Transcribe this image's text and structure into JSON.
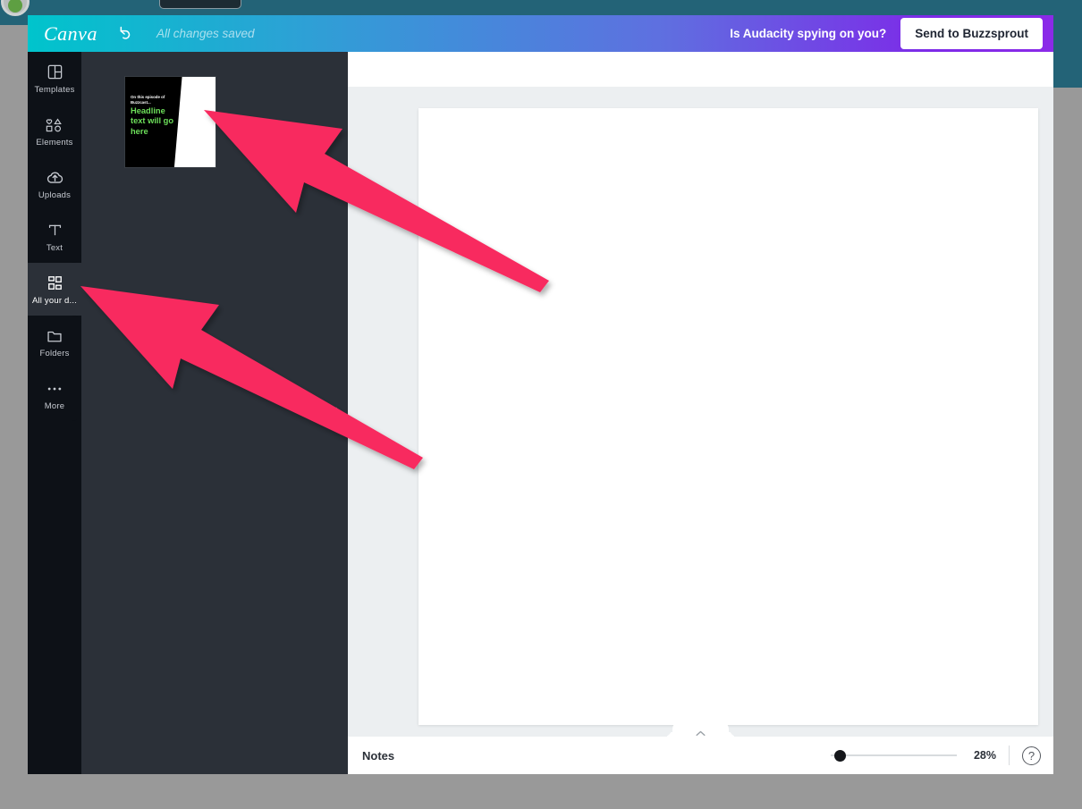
{
  "window": {
    "app_name": "Canva"
  },
  "underlay": {
    "avatar_icon": "user-avatar",
    "search_icon": "search-box"
  },
  "header": {
    "logo_text": "Canva",
    "undo_icon": "undo-arrow-icon",
    "save_status": "All changes saved",
    "doc_title": "Is Audacity spying on you?",
    "send_button": "Send to Buzzsprout"
  },
  "sidebar": {
    "items": [
      {
        "label": "Templates",
        "icon": "templates-icon",
        "active": false
      },
      {
        "label": "Elements",
        "icon": "elements-icon",
        "active": false
      },
      {
        "label": "Uploads",
        "icon": "uploads-cloud-icon",
        "active": false
      },
      {
        "label": "Text",
        "icon": "text-icon",
        "active": false
      },
      {
        "label": "All your d...",
        "icon": "all-your-designs-grid-icon",
        "active": true
      },
      {
        "label": "Folders",
        "icon": "folder-icon",
        "active": false
      },
      {
        "label": "More",
        "icon": "more-dots-icon",
        "active": false
      }
    ]
  },
  "panel": {
    "collapse_icon": "chevron-left-icon",
    "thumbnail": {
      "eyebrow": "On this episode of Buzzcast...",
      "headline": "Headline text will go here",
      "headline_color": "#6ddf5a",
      "background_color": "#000000"
    }
  },
  "notes": {
    "label": "Notes",
    "expand_icon": "chevron-up-icon"
  },
  "zoom": {
    "value": "28%",
    "percent": 28,
    "help_icon": "question-mark-icon"
  },
  "annotations": {
    "arrow_color": "#f8295e",
    "arrows": [
      {
        "name": "arrow-to-thumbnail",
        "points_at": "design-thumbnail"
      },
      {
        "name": "arrow-to-all-your-designs",
        "points_at": "sidebar-item-all-your-designs"
      }
    ]
  },
  "colors": {
    "header_gradient_start": "#00c4cc",
    "header_gradient_end": "#7d2ae8",
    "panel_background": "#2b3038",
    "rail_background": "#0d1117",
    "canvas_background": "#eceff1",
    "desktop_background": "#999999",
    "underlay_background": "#236377"
  }
}
